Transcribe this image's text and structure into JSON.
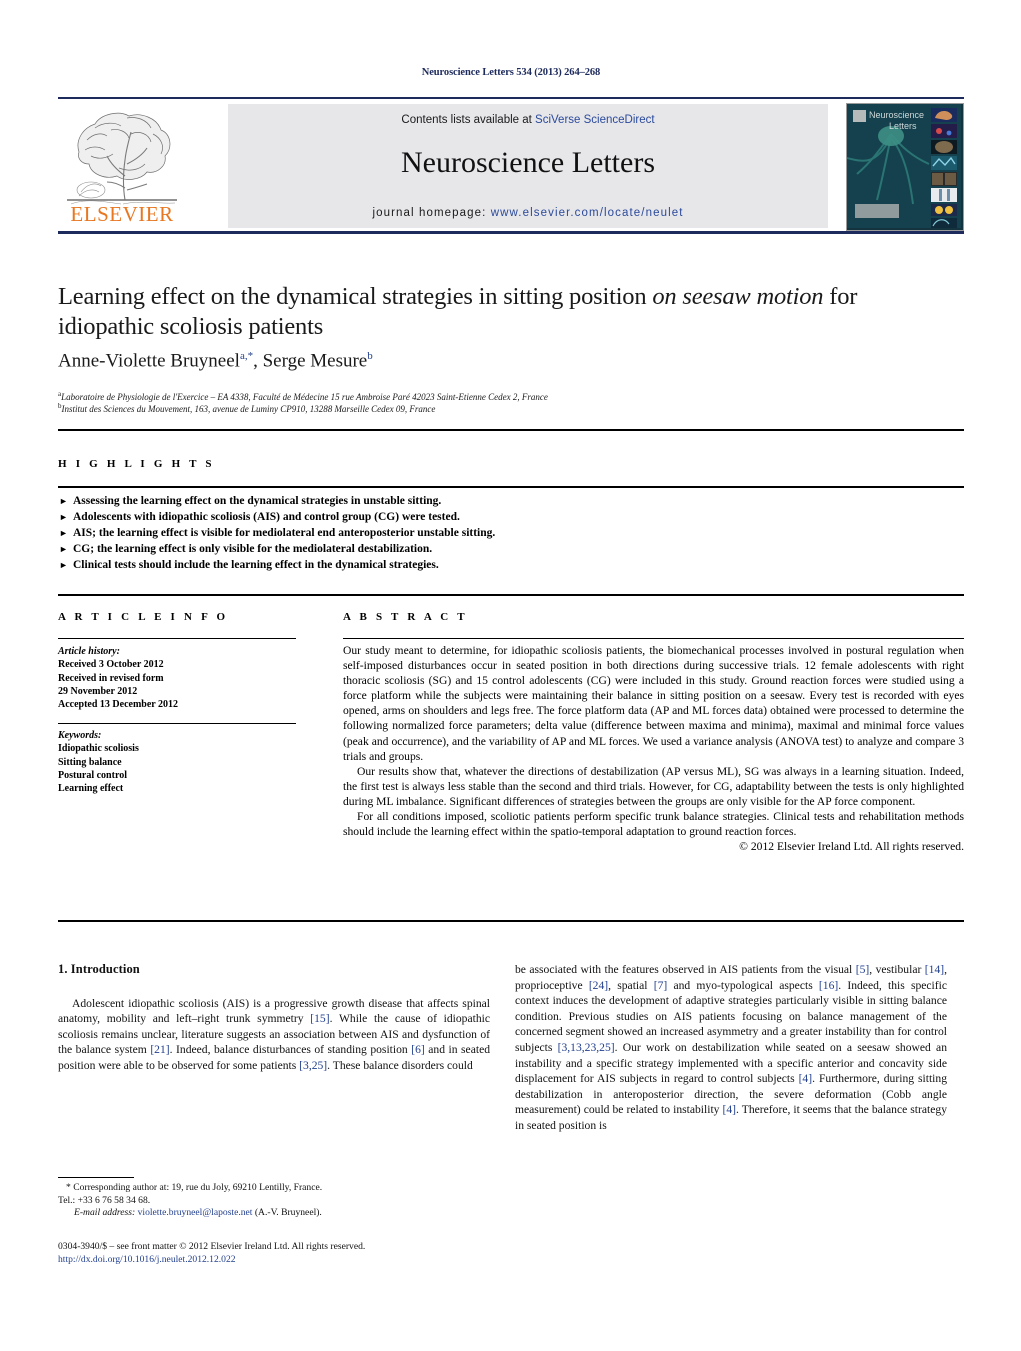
{
  "running_head": "Neuroscience Letters 534 (2013) 264–268",
  "banner": {
    "contents_prefix": "Contents lists available at ",
    "contents_link": "SciVerse ScienceDirect",
    "journal_name": "Neuroscience Letters",
    "homepage_prefix": "journal homepage: ",
    "homepage_link": "www.elsevier.com/locate/neulet",
    "publisher_logo_word": "ELSEVIER",
    "cover_title_line1": "Neuroscience",
    "cover_title_line2": "Letters",
    "accent_orange": "#e87722",
    "link_blue": "#2b4a9b",
    "navy": "#1d2a5c"
  },
  "article": {
    "title_part1": "Learning effect on the dynamical strategies in sitting position ",
    "title_italic": "on seesaw motion",
    "title_part2": " for idiopathic scoliosis patients",
    "authors": "Anne-Violette Bruyneel",
    "author1_sup": "a,*",
    "author2": ", Serge Mesure",
    "author2_sup": "b",
    "affiliation_a_sup": "a",
    "affiliation_a": "Laboratoire de Physiologie de l'Exercice – EA 4338, Faculté de Médecine 15 rue Ambroise Paré 42023 Saint-Etienne Cedex 2, France",
    "affiliation_b_sup": "b",
    "affiliation_b": "Institut des Sciences du Mouvement, 163, avenue de Luminy CP910, 13288 Marseille Cedex 09, France"
  },
  "highlights": {
    "label": "H I G H L I G H T S",
    "bullet_glyph": "►",
    "items": [
      "Assessing the learning effect on the dynamical strategies in unstable sitting.",
      "Adolescents with idiopathic scoliosis (AIS) and control group (CG) were tested.",
      "AIS; the learning effect is visible for mediolateral end anteroposterior unstable sitting.",
      "CG; the learning effect is only visible for the mediolateral destabilization.",
      "Clinical tests should include the learning effect in the dynamical strategies."
    ]
  },
  "article_info": {
    "label": "A R T I C L E    I N F O",
    "history_head": "Article history:",
    "history_lines": [
      "Received 3 October 2012",
      "Received in revised form",
      "29 November 2012",
      "Accepted 13 December 2012"
    ],
    "keywords_head": "Keywords:",
    "keywords": [
      "Idiopathic scoliosis",
      "Sitting balance",
      "Postural control",
      "Learning effect"
    ]
  },
  "abstract": {
    "label": "A B S T R A C T",
    "paragraphs": [
      "Our study meant to determine, for idiopathic scoliosis patients, the biomechanical processes involved in postural regulation when self-imposed disturbances occur in seated position in both directions during successive trials. 12 female adolescents with right thoracic scoliosis (SG) and 15 control adolescents (CG) were included in this study. Ground reaction forces were studied using a force platform while the subjects were maintaining their balance in sitting position on a seesaw. Every test is recorded with eyes opened, arms on shoulders and legs free. The force platform data (AP and ML forces data) obtained were processed to determine the following normalized force parameters; delta value (difference between maxima and minima), maximal and minimal force values (peak and occurrence), and the variability of AP and ML forces. We used a variance analysis (ANOVA test) to analyze and compare 3 trials and groups.",
      "Our results show that, whatever the directions of destabilization (AP versus ML), SG was always in a learning situation. Indeed, the first test is always less stable than the second and third trials. However, for CG, adaptability between the tests is only highlighted during ML imbalance. Significant differences of strategies between the groups are only visible for the AP force component.",
      "For all conditions imposed, scoliotic patients perform specific trunk balance strategies. Clinical tests and rehabilitation methods should include the learning effect within the spatio-temporal adaptation to ground reaction forces."
    ],
    "copyright": "© 2012 Elsevier Ireland Ltd. All rights reserved."
  },
  "body": {
    "section_number_title": "1.  Introduction",
    "left_paragraph": {
      "seg1": "Adolescent idiopathic scoliosis (AIS) is a progressive growth disease that affects spinal anatomy, mobility and left–right trunk symmetry ",
      "ref1": "[15]",
      "seg2": ". While the cause of idiopathic scoliosis remains unclear, literature suggests an association between AIS and dysfunction of the balance system ",
      "ref2": "[21]",
      "seg3": ". Indeed, balance disturbances of standing position ",
      "ref3": "[6]",
      "seg4": " and in seated position were able to be observed for some patients ",
      "ref4": "[3,25]",
      "seg5": ". These balance disorders could"
    },
    "right_paragraph": {
      "seg1": "be associated with the features observed in AIS patients from the visual ",
      "ref1": "[5]",
      "seg2": ", vestibular ",
      "ref2": "[14]",
      "seg3": ", proprioceptive ",
      "ref3": "[24]",
      "seg4": ", spatial ",
      "ref4": "[7]",
      "seg5": " and myo-typological aspects ",
      "ref5": "[16]",
      "seg6": ". Indeed, this specific context induces the development of adaptive strategies particularly visible in sitting balance condition. Previous studies on AIS patients focusing on balance management of the concerned segment showed an increased asymmetry and a greater instability than for control subjects ",
      "ref6": "[3,13,23,25]",
      "seg7": ". Our work on destabilization while seated on a seesaw showed an instability and a specific strategy implemented with a specific anterior and concavity side displacement for AIS subjects in regard to control subjects ",
      "ref7": "[4]",
      "seg8": ". Furthermore, during sitting destabilization in anteroposterior direction, the severe deformation (Cobb angle measurement) could be related to instability ",
      "ref8": "[4]",
      "seg9": ". Therefore, it seems that the balance strategy in seated position is"
    }
  },
  "footnotes": {
    "corresponding_marker": "*",
    "corresponding_text": " Corresponding author at: 19, rue du Joly, 69210 Lentilly, France.",
    "tel_line": "Tel.: +33 6 76 58 34 68.",
    "email_label": "E-mail address:",
    "email_link": " violette.bruyneel@laposte.net",
    "email_suffix": " (A.-V. Bruyneel).",
    "issn_line": "0304-3940/$ – see front matter © 2012 Elsevier Ireland Ltd. All rights reserved.",
    "doi_line": "http://dx.doi.org/10.1016/j.neulet.2012.12.022"
  }
}
